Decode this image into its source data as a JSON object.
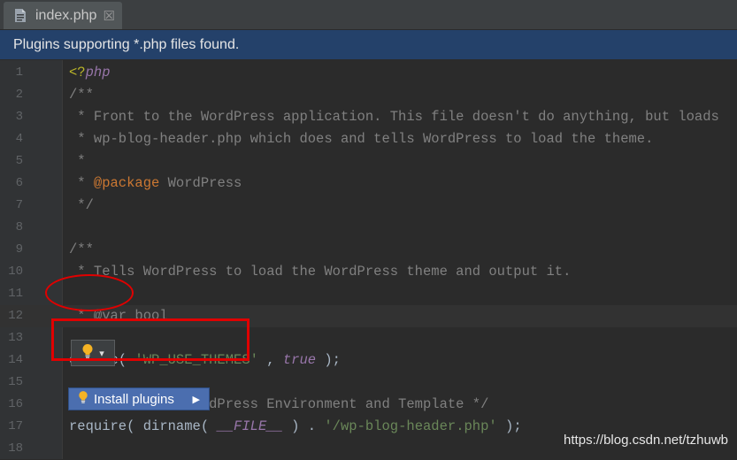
{
  "tab": {
    "title": "index.php",
    "icon": "php-file-icon",
    "close": "☒"
  },
  "banner": {
    "text": "Plugins supporting *.php files found."
  },
  "lines": [
    {
      "num": "1",
      "parts": [
        [
          "tag",
          "<?"
        ],
        [
          "italic",
          "php"
        ]
      ]
    },
    {
      "num": "2",
      "parts": [
        [
          "cmt",
          "/**"
        ]
      ]
    },
    {
      "num": "3",
      "parts": [
        [
          "cmt",
          " * Front to the WordPress application. This file doesn't do anything, but loads"
        ]
      ]
    },
    {
      "num": "4",
      "parts": [
        [
          "cmt",
          " * wp-blog-header.php which does and tells WordPress to load the theme."
        ]
      ]
    },
    {
      "num": "5",
      "parts": [
        [
          "cmt",
          " *"
        ]
      ]
    },
    {
      "num": "6",
      "parts": [
        [
          "cmt",
          " * "
        ],
        [
          "tagkw",
          "@package"
        ],
        [
          "cmt",
          " WordPress"
        ]
      ]
    },
    {
      "num": "7",
      "parts": [
        [
          "cmt",
          " */"
        ]
      ]
    },
    {
      "num": "8",
      "parts": []
    },
    {
      "num": "9",
      "parts": [
        [
          "cmt",
          "/**"
        ]
      ]
    },
    {
      "num": "10",
      "parts": [
        [
          "cmt",
          " * Tells WordPress to load the WordPress theme and output it."
        ]
      ]
    },
    {
      "num": "11",
      "parts": []
    },
    {
      "num": "12",
      "parts": [
        [
          "cmt",
          " * @var bool"
        ]
      ]
    },
    {
      "num": "13",
      "parts": []
    },
    {
      "num": "14",
      "parts": [
        [
          "plain",
          "define( "
        ],
        [
          "str",
          "'WP_USE_THEMES'"
        ],
        [
          "plain",
          " , "
        ],
        [
          "bool",
          "true"
        ],
        [
          "plain",
          " );"
        ]
      ]
    },
    {
      "num": "15",
      "parts": []
    },
    {
      "num": "16",
      "parts": [
        [
          "cmt",
          "/** Loads the WordPress Environment and Template */"
        ]
      ]
    },
    {
      "num": "17",
      "parts": [
        [
          "plain",
          "require( dirname( "
        ],
        [
          "const",
          "__FILE__"
        ],
        [
          "plain",
          " ) . "
        ],
        [
          "str",
          "'/wp-blog-header.php'"
        ],
        [
          "plain",
          " );"
        ]
      ]
    },
    {
      "num": "18",
      "parts": []
    }
  ],
  "current_line": "12",
  "intention": {
    "icon": "lightbulb-icon",
    "arrow": "▾"
  },
  "popup": {
    "label": "Install plugins",
    "icon": "lightbulb-icon",
    "arrow": "▶"
  },
  "watermark": "https://blog.csdn.net/tzhuwb",
  "colors": {
    "accent": "#4b6eaf",
    "banner": "#24416a",
    "annotation": "#e00000",
    "bulb": "#f5b324"
  }
}
